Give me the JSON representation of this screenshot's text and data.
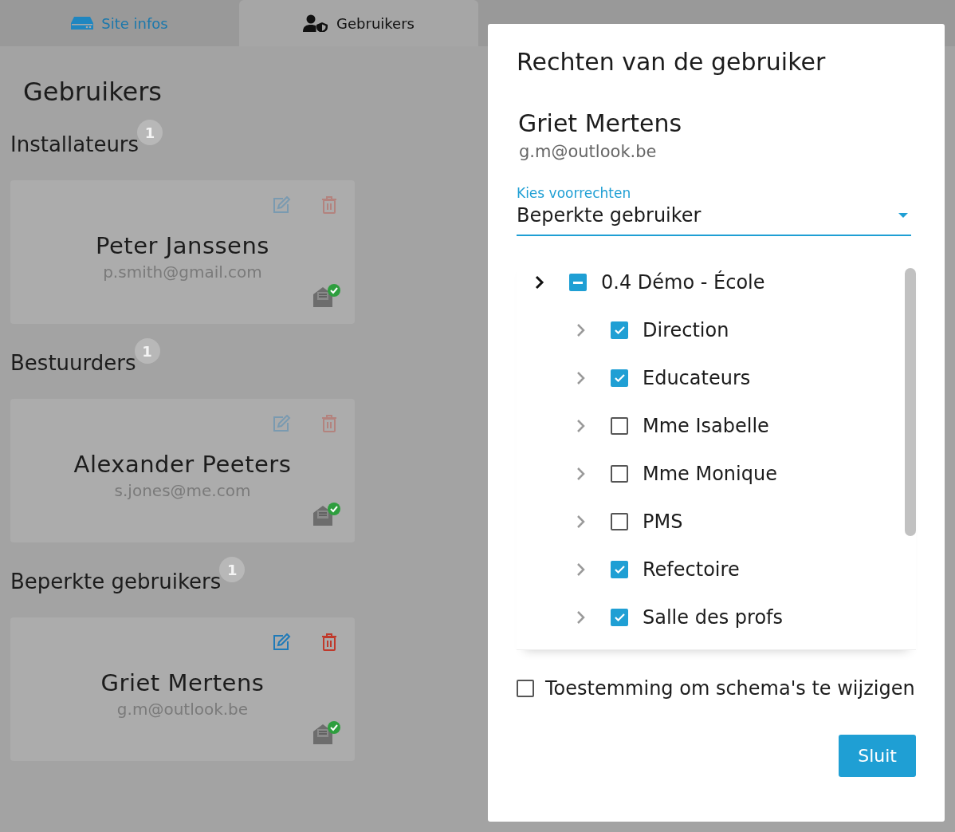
{
  "tabs": [
    {
      "label": "Site infos",
      "selected": false
    },
    {
      "label": "Gebruikers",
      "selected": true
    }
  ],
  "page": {
    "title": "Gebruikers"
  },
  "groups": [
    {
      "title": "Installateurs",
      "count": "1",
      "users": [
        {
          "name": "Peter Janssens",
          "email": "p.smith@gmail.com",
          "active": false
        }
      ]
    },
    {
      "title": "Bestuurders",
      "count": "1",
      "users": [
        {
          "name": "Alexander Peeters",
          "email": "s.jones@me.com",
          "active": false
        }
      ]
    },
    {
      "title": "Beperkte gebruikers",
      "count": "1",
      "users": [
        {
          "name": "Griet Mertens",
          "email": "g.m@outlook.be",
          "active": true
        }
      ]
    }
  ],
  "dialog": {
    "title": "Rechten van de gebruiker",
    "user_name": "Griet Mertens",
    "user_email": "g.m@outlook.be",
    "select": {
      "label": "Kies voorrechten",
      "value": "Beperkte gebruiker"
    },
    "tree": [
      {
        "label": "0.4 Démo - École",
        "checked": true,
        "indeterminate": true,
        "children": [
          {
            "label": "Direction",
            "checked": true
          },
          {
            "label": "Educateurs",
            "checked": true
          },
          {
            "label": "Mme Isabelle",
            "checked": false
          },
          {
            "label": "Mme Monique",
            "checked": false
          },
          {
            "label": "PMS",
            "checked": false
          },
          {
            "label": "Refectoire",
            "checked": true
          },
          {
            "label": "Salle des profs",
            "checked": true
          }
        ]
      }
    ],
    "permission": {
      "label": "Toestemming om schema's te wijzigen",
      "checked": false
    },
    "close_button": "Sluit"
  }
}
